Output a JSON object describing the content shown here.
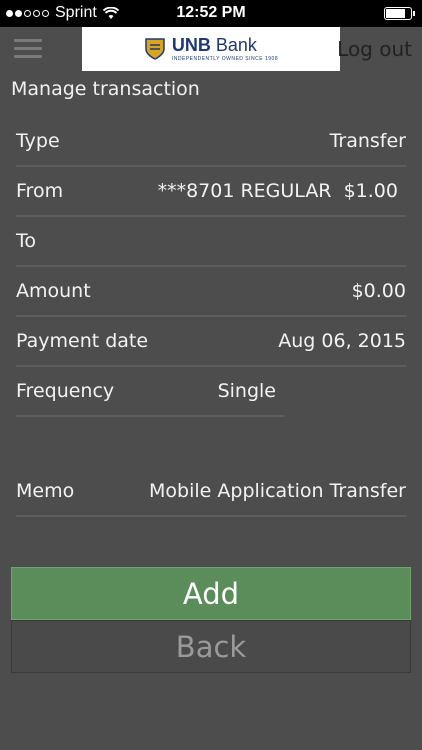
{
  "status_bar": {
    "carrier": "Sprint",
    "time": "12:52 PM",
    "signal_bars_filled": 2,
    "signal_bars_total": 5,
    "battery_level": 0.8
  },
  "header": {
    "logo_name": "UNB",
    "logo_suffix": "Bank",
    "logo_tagline": "INDEPENDENTLY OWNED SINCE 1908",
    "logout_label": "Log out"
  },
  "page_title": "Manage transaction",
  "fields": {
    "type": {
      "label": "Type",
      "value": "Transfer"
    },
    "from": {
      "label": "From",
      "value": "***8701 REGULAR  $1.00"
    },
    "to": {
      "label": "To",
      "value": ""
    },
    "amount": {
      "label": "Amount",
      "value": "$0.00"
    },
    "payment_date": {
      "label": "Payment date",
      "value": "Aug 06, 2015"
    },
    "frequency": {
      "label": "Frequency",
      "value": "Single"
    },
    "memo": {
      "label": "Memo",
      "value": "Mobile Application Transfer"
    }
  },
  "buttons": {
    "add_label": "Add",
    "back_label": "Back"
  },
  "colors": {
    "background": "#4d4d4d",
    "add_button": "#5a8d5a",
    "brand_blue": "#1f3a73"
  }
}
